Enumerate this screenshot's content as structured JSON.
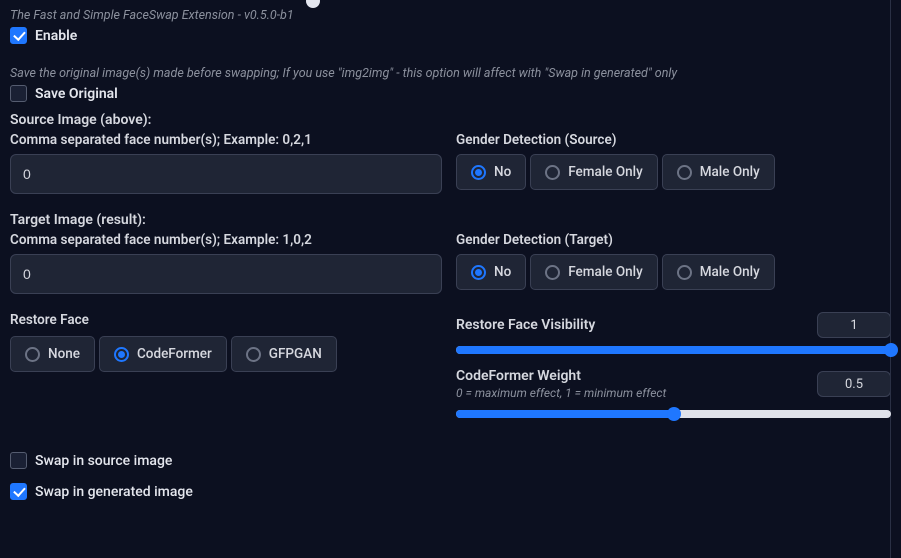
{
  "header": {
    "subtitle": "The Fast and Simple FaceSwap Extension - v0.5.0-b1",
    "enable_label": "Enable",
    "enable_checked": true
  },
  "save_original": {
    "desc": "Save the original image(s) made before swapping; If you use \"img2img\" - this option will affect with \"Swap in generated\" only",
    "label": "Save Original",
    "checked": false
  },
  "source": {
    "heading": "Source Image (above):",
    "face_numbers_label": "Comma separated face number(s); Example: 0,2,1",
    "face_numbers_value": "0",
    "gender_label": "Gender Detection (Source)",
    "gender_opts": [
      "No",
      "Female Only",
      "Male Only"
    ],
    "gender_selected": 0
  },
  "target": {
    "heading": "Target Image (result):",
    "face_numbers_label": "Comma separated face number(s); Example: 1,0,2",
    "face_numbers_value": "0",
    "gender_label": "Gender Detection (Target)",
    "gender_opts": [
      "No",
      "Female Only",
      "Male Only"
    ],
    "gender_selected": 0
  },
  "restore_face": {
    "label": "Restore Face",
    "opts": [
      "None",
      "CodeFormer",
      "GFPGAN"
    ],
    "selected": 1
  },
  "visibility": {
    "label": "Restore Face Visibility",
    "value": "1",
    "fill_pct": 100
  },
  "cf_weight": {
    "label": "CodeFormer Weight",
    "hint": "0 = maximum effect, 1 = minimum effect",
    "value": "0.5",
    "fill_pct": 50
  },
  "swap_source": {
    "label": "Swap in source image",
    "checked": false
  },
  "swap_generated": {
    "label": "Swap in generated image",
    "checked": true
  }
}
